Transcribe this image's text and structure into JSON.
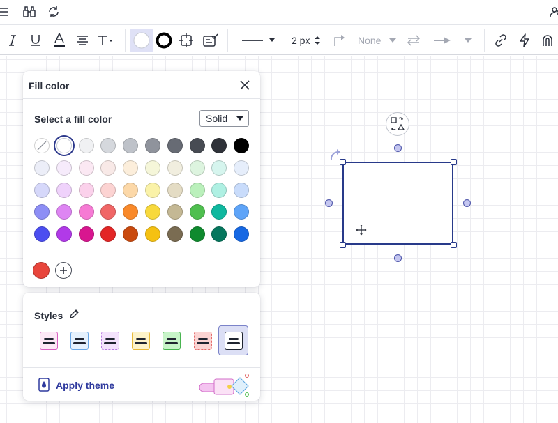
{
  "colors": {
    "accent": "#2f3a9e",
    "shape_border": "#283a8a",
    "custom_color": "#e8453c"
  },
  "topbar": {
    "icons": [
      "menu-icon",
      "binoculars-icon",
      "refresh-icon",
      "users-icon"
    ]
  },
  "toolbar": {
    "line_width_value": "2 px",
    "line_end_value": "None",
    "icons": [
      "italic-icon",
      "underline-icon",
      "text-color-icon",
      "align-center-icon",
      "text-style-icon",
      "fill-color-icon",
      "border-color-icon",
      "crop-icon",
      "checklist-icon",
      "line-style-icon",
      "connector-icon",
      "swap-icon",
      "arrow-end-icon",
      "link-icon",
      "lightning-icon",
      "magnet-icon"
    ]
  },
  "fill_panel": {
    "title": "Fill color",
    "select_label": "Select a fill color",
    "mode_value": "Solid",
    "palette": [
      [
        "none",
        "#ffffff",
        "#f0f1f3",
        "#d5d8dd",
        "#bec2c9",
        "#8f939c",
        "#676b74",
        "#474b53",
        "#2f3239",
        "#000000"
      ],
      [
        "#eceef8",
        "#f6ebfb",
        "#fbe8f3",
        "#f8e9e7",
        "#fceedb",
        "#f5f6d9",
        "#f1eedf",
        "#ddf4df",
        "#d6f5ee",
        "#e6eefb"
      ],
      [
        "#d6d8fa",
        "#efd2fb",
        "#fbd1eb",
        "#fcd3d2",
        "#fcd8a8",
        "#faf2a8",
        "#e4dcc4",
        "#baf0bb",
        "#aff0e3",
        "#c9dcfb"
      ],
      [
        "#8d8ef5",
        "#de85f3",
        "#f67ad4",
        "#f06666",
        "#f9892a",
        "#f8d93c",
        "#c4b894",
        "#4fbf4f",
        "#0fb89f",
        "#5ea4f8"
      ],
      [
        "#4b4ef0",
        "#b13ae8",
        "#d8168f",
        "#e32626",
        "#c94a0e",
        "#f5c112",
        "#7a6c52",
        "#0f8a2e",
        "#06775e",
        "#1668e3"
      ]
    ],
    "custom_colors": [
      "#e8453c"
    ]
  },
  "styles_panel": {
    "title": "Styles",
    "apply_theme_label": "Apply theme",
    "styles": [
      {
        "name": "pink",
        "bg": "#fde8f6",
        "border": "#d85fc0"
      },
      {
        "name": "blue",
        "bg": "#e5f1fd",
        "border": "#6aa7e6"
      },
      {
        "name": "purple-dashed",
        "bg": "#f3e2fc",
        "border": "#b77be0"
      },
      {
        "name": "yellow",
        "bg": "#fdf3c9",
        "border": "#e8b93a"
      },
      {
        "name": "green",
        "bg": "#c7f4c8",
        "border": "#49b450"
      },
      {
        "name": "red-dashed",
        "bg": "#fbd4d3",
        "border": "#e46a6a"
      },
      {
        "name": "outline",
        "bg": "#ffffff",
        "border": "#1f2430"
      }
    ]
  }
}
